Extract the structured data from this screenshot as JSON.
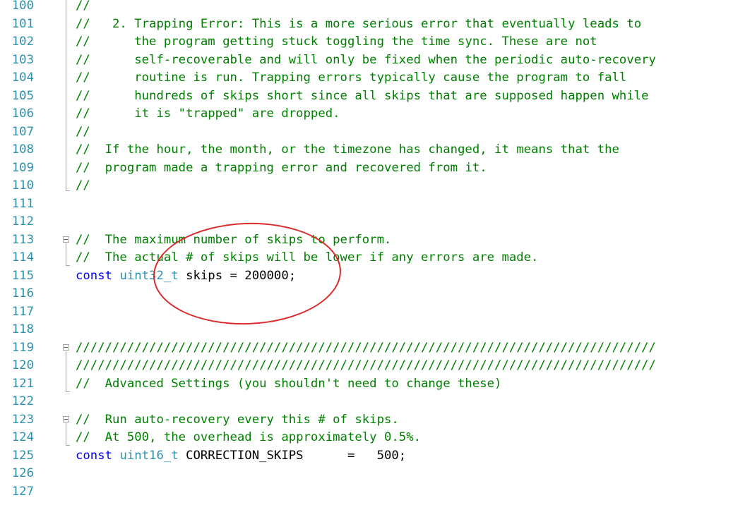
{
  "editor": {
    "lines": [
      {
        "num": "100",
        "segments": [
          {
            "cls": "comment",
            "text": "//"
          }
        ]
      },
      {
        "num": "101",
        "segments": [
          {
            "cls": "comment",
            "text": "//   2. Trapping Error: This is a more serious error that eventually leads to"
          }
        ]
      },
      {
        "num": "102",
        "segments": [
          {
            "cls": "comment",
            "text": "//      the program getting stuck toggling the time sync. These are not"
          }
        ]
      },
      {
        "num": "103",
        "segments": [
          {
            "cls": "comment",
            "text": "//      self-recoverable and will only be fixed when the periodic auto-recovery"
          }
        ]
      },
      {
        "num": "104",
        "segments": [
          {
            "cls": "comment",
            "text": "//      routine is run. Trapping errors typically cause the program to fall"
          }
        ]
      },
      {
        "num": "105",
        "segments": [
          {
            "cls": "comment",
            "text": "//      hundreds of skips short since all skips that are supposed happen while"
          }
        ]
      },
      {
        "num": "106",
        "segments": [
          {
            "cls": "comment",
            "text": "//      it is \"trapped\" are dropped."
          }
        ]
      },
      {
        "num": "107",
        "segments": [
          {
            "cls": "comment",
            "text": "//"
          }
        ]
      },
      {
        "num": "108",
        "segments": [
          {
            "cls": "comment",
            "text": "//  If the hour, the month, or the timezone has changed, it means that the"
          }
        ]
      },
      {
        "num": "109",
        "segments": [
          {
            "cls": "comment",
            "text": "//  program made a trapping error and recovered from it."
          }
        ]
      },
      {
        "num": "110",
        "segments": [
          {
            "cls": "comment",
            "text": "//"
          }
        ]
      },
      {
        "num": "111",
        "segments": []
      },
      {
        "num": "112",
        "segments": []
      },
      {
        "num": "113",
        "segments": [
          {
            "cls": "comment",
            "text": "//  The maximum number of skips to perform."
          }
        ]
      },
      {
        "num": "114",
        "segments": [
          {
            "cls": "comment",
            "text": "//  The actual # of skips will be lower if any errors are made."
          }
        ]
      },
      {
        "num": "115",
        "segments": [
          {
            "cls": "kw",
            "text": "const"
          },
          {
            "cls": "plain",
            "text": " "
          },
          {
            "cls": "type",
            "text": "uint32_t"
          },
          {
            "cls": "plain",
            "text": " skips = 200000;"
          }
        ]
      },
      {
        "num": "116",
        "segments": []
      },
      {
        "num": "117",
        "segments": []
      },
      {
        "num": "118",
        "segments": []
      },
      {
        "num": "119",
        "segments": [
          {
            "cls": "comment",
            "text": "///////////////////////////////////////////////////////////////////////////////"
          }
        ]
      },
      {
        "num": "120",
        "segments": [
          {
            "cls": "comment",
            "text": "///////////////////////////////////////////////////////////////////////////////"
          }
        ]
      },
      {
        "num": "121",
        "segments": [
          {
            "cls": "comment",
            "text": "//  Advanced Settings (you shouldn't need to change these)"
          }
        ]
      },
      {
        "num": "122",
        "segments": []
      },
      {
        "num": "123",
        "segments": [
          {
            "cls": "comment",
            "text": "//  Run auto-recovery every this # of skips."
          }
        ]
      },
      {
        "num": "124",
        "segments": [
          {
            "cls": "comment",
            "text": "//  At 500, the overhead is approximately 0.5%."
          }
        ]
      },
      {
        "num": "125",
        "segments": [
          {
            "cls": "kw",
            "text": "const"
          },
          {
            "cls": "plain",
            "text": " "
          },
          {
            "cls": "type",
            "text": "uint16_t"
          },
          {
            "cls": "plain",
            "text": " CORRECTION_SKIPS      =   500;"
          }
        ]
      },
      {
        "num": "126",
        "segments": []
      },
      {
        "num": "127",
        "segments": []
      }
    ]
  },
  "annotation": {
    "shape": "ellipse",
    "color": "#d92b2b"
  },
  "colors": {
    "line_number": "#2b91af",
    "comment": "#008000",
    "keyword": "#0000ff",
    "type": "#2b91af",
    "plain": "#000000"
  }
}
